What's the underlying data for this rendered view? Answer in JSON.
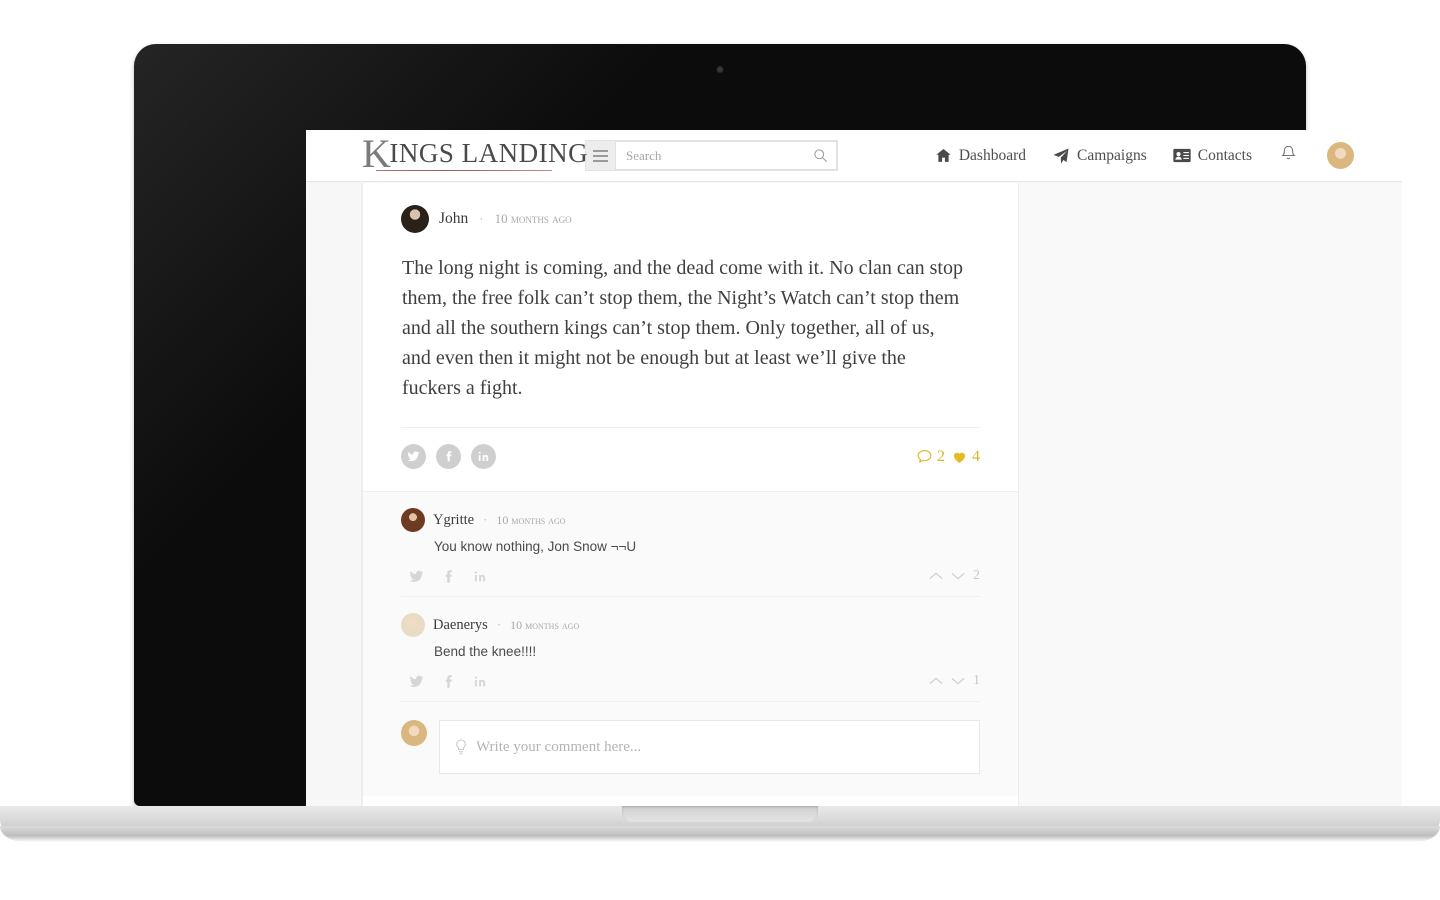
{
  "brand": {
    "initial": "K",
    "name": "INGS LANDING"
  },
  "search": {
    "value": "",
    "placeholder": "Search",
    "icon": "search-icon",
    "menu_icon": "hamburger-icon"
  },
  "nav": {
    "items": [
      {
        "label": "Dashboard",
        "icon": "home-icon"
      },
      {
        "label": "Campaigns",
        "icon": "paper-plane-icon"
      },
      {
        "label": "Contacts",
        "icon": "contact-card-icon"
      }
    ],
    "notifications_icon": "bell-icon",
    "avatar": "user-avatar"
  },
  "post": {
    "author": "John",
    "separator": "·",
    "time": "10 months ago",
    "body": "The long night is coming, and the dead come with it. No clan can stop them, the free folk can’t stop them, the Night’s Watch can’t stop them and all the southern kings can’t stop them. Only together, all of us, and even then it might not be enough but at least we’ll give the fuckers a fight.",
    "share": [
      {
        "network": "twitter-icon"
      },
      {
        "network": "facebook-icon"
      },
      {
        "network": "linkedin-icon"
      }
    ],
    "comment_count": "2",
    "like_count": "4",
    "comment_icon": "speech-bubble-icon",
    "like_icon": "heart-icon",
    "accent_color": "#e0b81f"
  },
  "comments": [
    {
      "author": "Ygritte",
      "separator": "·",
      "time": "10 months ago",
      "text": "You know nothing, Jon Snow ¬¬U",
      "votes": "2",
      "upvote_icon": "chevron-up-icon",
      "downvote_icon": "chevron-down-icon",
      "share": [
        {
          "network": "twitter-icon"
        },
        {
          "network": "facebook-icon"
        },
        {
          "network": "linkedin-icon"
        }
      ]
    },
    {
      "author": "Daenerys",
      "separator": "·",
      "time": "10 months ago",
      "text": "Bend the knee!!!!",
      "votes": "1",
      "upvote_icon": "chevron-up-icon",
      "downvote_icon": "chevron-down-icon",
      "share": [
        {
          "network": "twitter-icon"
        },
        {
          "network": "facebook-icon"
        },
        {
          "network": "linkedin-icon"
        }
      ]
    }
  ],
  "composer": {
    "value": "",
    "placeholder": "Write your comment here...",
    "icon": "lightbulb-icon",
    "avatar": "user-avatar"
  }
}
